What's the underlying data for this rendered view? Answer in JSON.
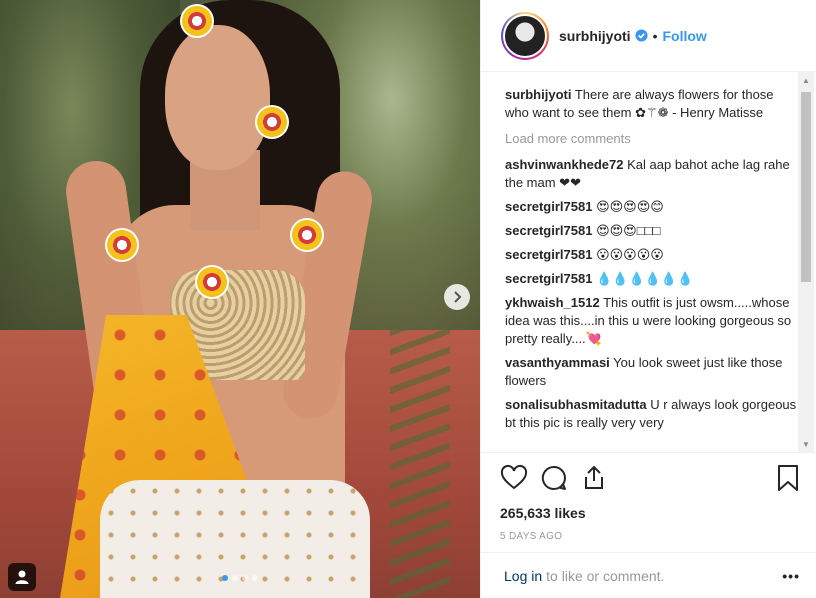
{
  "post": {
    "username": "surbhijyoti",
    "follow_label": "Follow",
    "separator": "•",
    "caption_text": "There are always flowers for those who want to see them ✿⚚❁ - Henry Matisse",
    "load_more_label": "Load more comments",
    "comments": [
      {
        "author": "ashvinwankhede72",
        "text": "Kal aap bahot ache lag rahe the mam ❤❤"
      },
      {
        "author": "secretgirl7581",
        "text": "😍😍😍😍😊"
      },
      {
        "author": "secretgirl7581",
        "text": "😍😍😍□□□"
      },
      {
        "author": "secretgirl7581",
        "text": "😮😮😮😮😮"
      },
      {
        "author": "secretgirl7581",
        "text": "💧💧💧💧💧💧"
      },
      {
        "author": "ykhwaish_1512",
        "text": "This outfit is just owsm.....whose idea was this....in this u were looking gorgeous so pretty really....💘"
      },
      {
        "author": "vasanthyammasi",
        "text": "You look sweet just like those flowers"
      },
      {
        "author": "sonalisubhasmitadutta",
        "text": "U r always look gorgeous bt this pic is really very very"
      }
    ],
    "likes_label": "265,633 likes",
    "time_ago": "5 DAYS AGO",
    "login_label": "Log in",
    "login_suffix": "to like or comment.",
    "more_label": "•••"
  },
  "carousel": {
    "slide_count": 4,
    "active_slide": 1
  },
  "colors": {
    "accent": "#3897f0",
    "muted": "#999999",
    "text": "#262626"
  },
  "icons": [
    "verified-badge-icon",
    "heart-icon",
    "comment-icon",
    "share-icon",
    "bookmark-icon",
    "next-arrow-icon",
    "user-tag-icon",
    "more-options-icon"
  ]
}
